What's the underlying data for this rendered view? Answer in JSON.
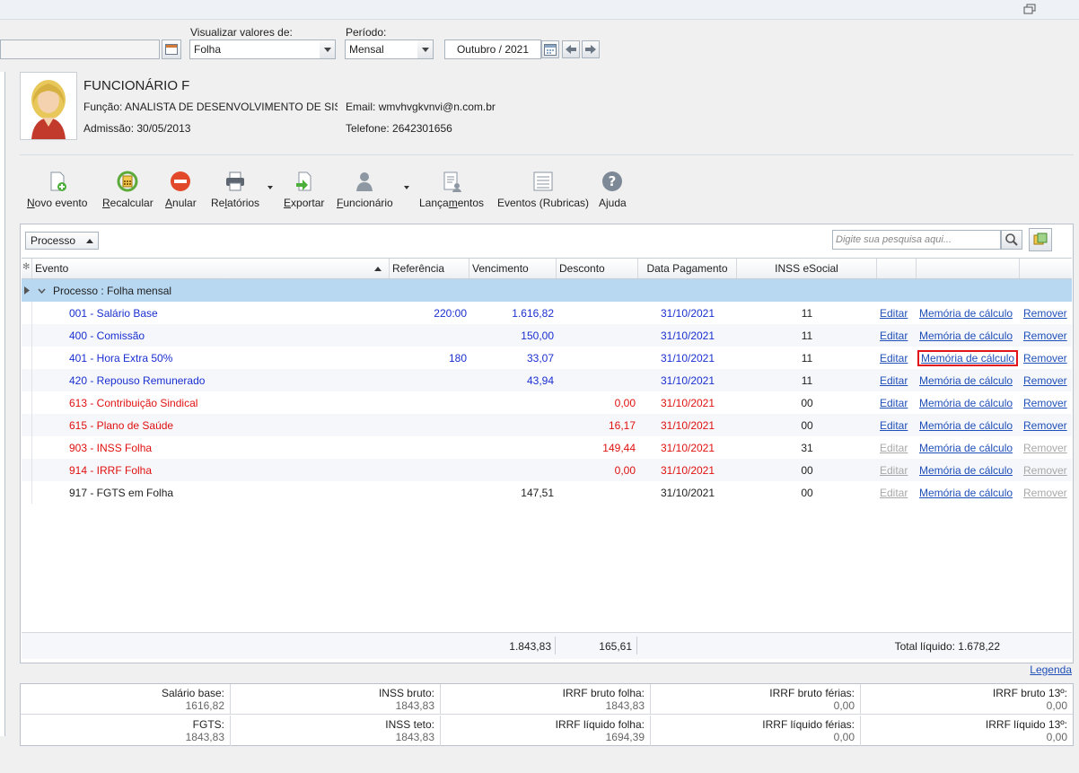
{
  "filters": {
    "view_label": "Visualizar valores de:",
    "view_value": "Folha",
    "period_label": "Período:",
    "period_value": "Mensal",
    "month_value": "Outubro / 2021"
  },
  "employee": {
    "name": "FUNCIONÁRIO F",
    "role_label": "Função:",
    "role_value": "ANALISTA DE DESENVOLVIMENTO DE SISTEM",
    "admission_label": "Admissão:",
    "admission_value": "30/05/2013",
    "email_label": "Email:",
    "email_value": "wmvhvgkvnvi@n.com.br",
    "phone_label": "Telefone:",
    "phone_value": "2642301656"
  },
  "toolbar": {
    "new_event_pre": "",
    "new_event_u": "N",
    "new_event_post": "ovo evento",
    "recalc_pre": "",
    "recalc_u": "R",
    "recalc_post": "ecalcular",
    "cancel_pre": "",
    "cancel_u": "A",
    "cancel_post": "nular",
    "reports_pre": "Re",
    "reports_u": "l",
    "reports_post": "atórios",
    "export_pre": "",
    "export_u": "E",
    "export_post": "xportar",
    "employee_pre": "",
    "employee_u": "F",
    "employee_post": "uncionário",
    "entries_pre": "Lança",
    "entries_u": "m",
    "entries_post": "entos",
    "events": "Eventos (Rubricas)",
    "help": "Ajuda"
  },
  "grid": {
    "group_by": "Processo",
    "search_placeholder": "Digite sua pesquisa aqui...",
    "columns": {
      "evento": "Evento",
      "referencia": "Referência",
      "vencimento": "Vencimento",
      "desconto": "Desconto",
      "data_pagamento": "Data Pagamento",
      "inss": "INSS eSocial"
    },
    "group_row": "Processo : Folha mensal",
    "rows": [
      {
        "evento": "001 - Salário Base",
        "ref": "220:00",
        "venc": "1.616,82",
        "desc": "",
        "data": "31/10/2021",
        "inss": "11",
        "editar": "Editar",
        "memoria": "Memória de cálculo",
        "remover": "Remover"
      },
      {
        "evento": "400 - Comissão",
        "ref": "",
        "venc": "150,00",
        "desc": "",
        "data": "31/10/2021",
        "inss": "11",
        "editar": "Editar",
        "memoria": "Memória de cálculo",
        "remover": "Remover"
      },
      {
        "evento": "401 - Hora Extra 50%",
        "ref": "180",
        "venc": "33,07",
        "desc": "",
        "data": "31/10/2021",
        "inss": "11",
        "editar": "Editar",
        "memoria": "Memória de cálculo",
        "remover": "Remover"
      },
      {
        "evento": "420 - Repouso Remunerado",
        "ref": "",
        "venc": "43,94",
        "desc": "",
        "data": "31/10/2021",
        "inss": "11",
        "editar": "Editar",
        "memoria": "Memória de cálculo",
        "remover": "Remover"
      },
      {
        "evento": "613 - Contribuição Sindical",
        "ref": "",
        "venc": "",
        "desc": "0,00",
        "data": "31/10/2021",
        "inss": "00",
        "editar": "Editar",
        "memoria": "Memória de cálculo",
        "remover": "Remover"
      },
      {
        "evento": "615 - Plano de Saúde",
        "ref": "",
        "venc": "",
        "desc": "16,17",
        "data": "31/10/2021",
        "inss": "00",
        "editar": "Editar",
        "memoria": "Memória de cálculo",
        "remover": "Remover"
      },
      {
        "evento": "903 - INSS Folha",
        "ref": "",
        "venc": "",
        "desc": "149,44",
        "data": "31/10/2021",
        "inss": "31",
        "editar": "Editar",
        "memoria": "Memória de cálculo",
        "remover": "Remover"
      },
      {
        "evento": "914 - IRRF Folha",
        "ref": "",
        "venc": "",
        "desc": "0,00",
        "data": "31/10/2021",
        "inss": "00",
        "editar": "Editar",
        "memoria": "Memória de cálculo",
        "remover": "Remover"
      },
      {
        "evento": "917 - FGTS em Folha",
        "ref": "",
        "venc": "147,51",
        "desc": "",
        "data": "31/10/2021",
        "inss": "00",
        "editar": "Editar",
        "memoria": "Memória de cálculo",
        "remover": "Remover"
      }
    ],
    "total_venc": "1.843,83",
    "total_desc": "165,61",
    "total_liquido": "Total líquido: 1.678,22",
    "legend_link": "Legenda"
  },
  "summary": {
    "r1": [
      {
        "k": "Salário base:",
        "v": "1616,82"
      },
      {
        "k": "INSS bruto:",
        "v": "1843,83"
      },
      {
        "k": "IRRF bruto folha:",
        "v": "1843,83"
      },
      {
        "k": "IRRF bruto férias:",
        "v": "0,00"
      },
      {
        "k": "IRRF bruto 13º:",
        "v": "0,00"
      }
    ],
    "r2": [
      {
        "k": "FGTS:",
        "v": "1843,83"
      },
      {
        "k": "INSS teto:",
        "v": "1843,83"
      },
      {
        "k": "IRRF líquido folha:",
        "v": "1694,39"
      },
      {
        "k": "IRRF líquido férias:",
        "v": "0,00"
      },
      {
        "k": "IRRF líquido 13º:",
        "v": "0,00"
      }
    ]
  },
  "colors": {
    "blue_text": "#1a2fd0",
    "red_text": "#e01010",
    "group_bg": "#b8d8f2",
    "link": "#1f4fb8"
  }
}
